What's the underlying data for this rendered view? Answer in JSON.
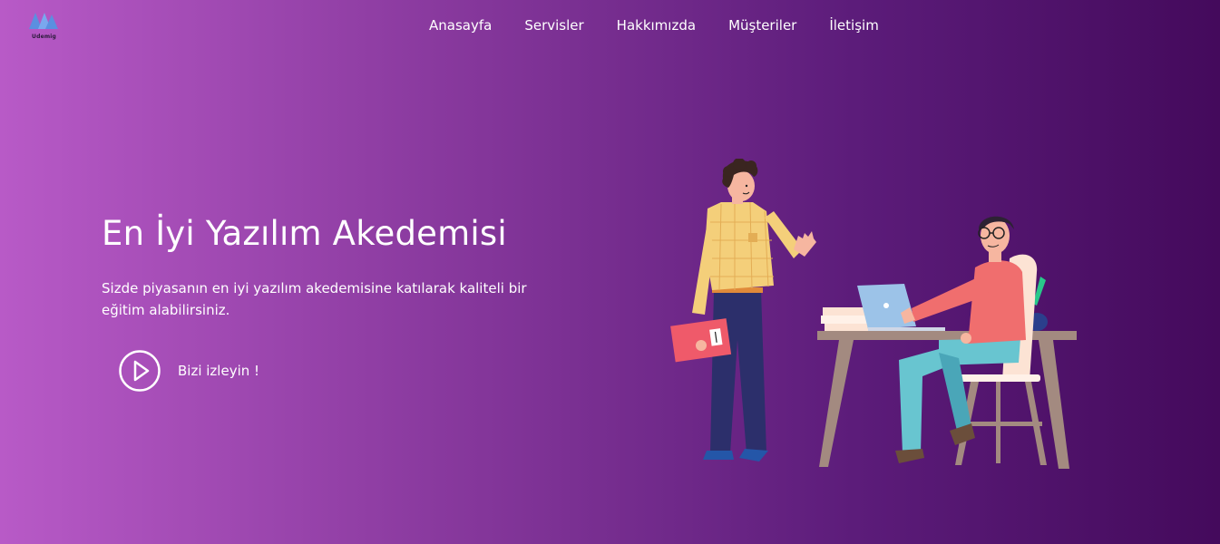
{
  "brand": {
    "name": "Udemig"
  },
  "nav": {
    "items": [
      {
        "label": "Anasayfa"
      },
      {
        "label": "Servisler"
      },
      {
        "label": "Hakkımızda"
      },
      {
        "label": "Müşteriler"
      },
      {
        "label": "İletişim"
      }
    ]
  },
  "hero": {
    "title": "En İyi Yazılım Akedemisi",
    "description": "Sizde piyasanın en iyi yazılım akedemisine katılarak kaliteli bir eğitim alabilirsiniz.",
    "watch_label": "Bizi izleyin !"
  },
  "colors": {
    "background_start": "#b85ac7",
    "background_end": "#440a5c",
    "text": "#ffffff"
  },
  "icons": {
    "logo": "brand-logo-icon",
    "play": "play-circle-icon"
  }
}
